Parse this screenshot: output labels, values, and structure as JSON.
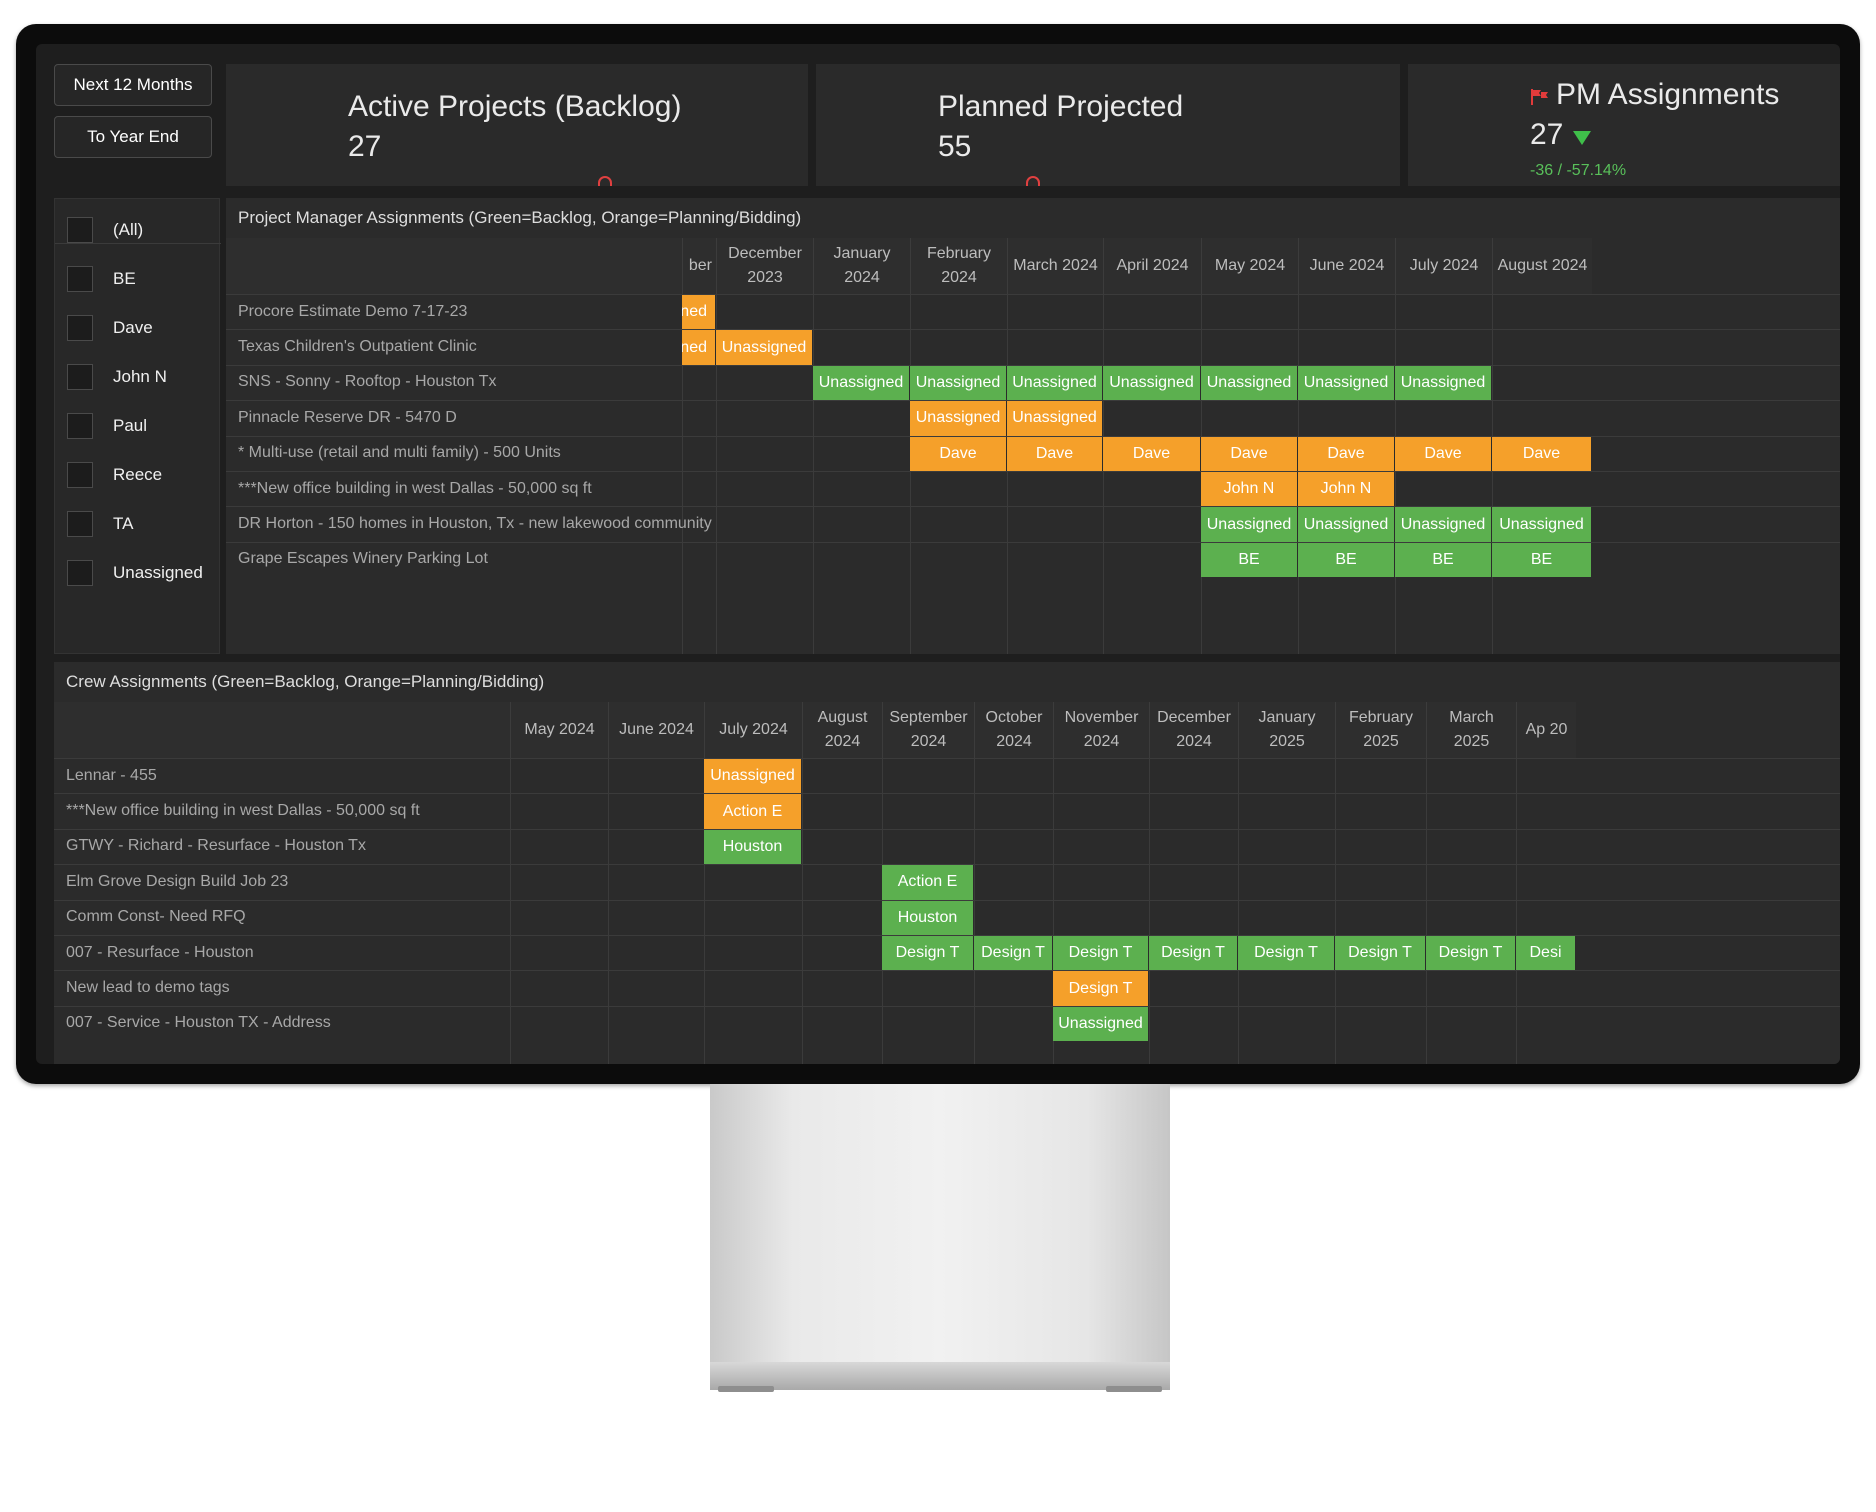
{
  "filters_time": {
    "next12": "Next 12 Months",
    "year_end": "To Year End"
  },
  "kpis": [
    {
      "title": "Active Projects (Backlog)",
      "value": "27"
    },
    {
      "title": "Planned Projected",
      "value": "55"
    },
    {
      "title": "PM Assignments",
      "value": "27",
      "delta": "-36 / -57.14%"
    }
  ],
  "colors": {
    "green": "#5cb04f",
    "orange": "#f5a02a"
  },
  "pm_filter": [
    "(All)",
    "BE",
    "Dave",
    "John N",
    "Paul",
    "Reece",
    "TA",
    "Unassigned"
  ],
  "pm_grid": {
    "title": "Project Manager Assignments (Green=Backlog, Orange=Planning/Bidding)",
    "months": [
      "ber",
      "December 2023",
      "January 2024",
      "February 2024",
      "March 2024",
      "April 2024",
      "May 2024",
      "June 2024",
      "July 2024",
      "August 2024"
    ],
    "rows": [
      {
        "label": "Procore Estimate Demo 7-17-23",
        "cells": [
          {
            "col": 0,
            "text": "ned",
            "c": "o"
          }
        ]
      },
      {
        "label": "Texas Children's Outpatient Clinic",
        "cells": [
          {
            "col": 0,
            "text": "ned",
            "c": "o"
          },
          {
            "col": 1,
            "text": "Unassigned",
            "c": "o"
          }
        ]
      },
      {
        "label": "SNS - Sonny - Rooftop - Houston Tx",
        "cells": [
          {
            "col": 2,
            "text": "Unassigned",
            "c": "g"
          },
          {
            "col": 3,
            "text": "Unassigned",
            "c": "g"
          },
          {
            "col": 4,
            "text": "Unassigned",
            "c": "g"
          },
          {
            "col": 5,
            "text": "Unassigned",
            "c": "g"
          },
          {
            "col": 6,
            "text": "Unassigned",
            "c": "g"
          },
          {
            "col": 7,
            "text": "Unassigned",
            "c": "g"
          },
          {
            "col": 8,
            "text": "Unassigned",
            "c": "g"
          }
        ]
      },
      {
        "label": "Pinnacle Reserve DR - 5470 D",
        "cells": [
          {
            "col": 3,
            "text": "Unassigned",
            "c": "o"
          },
          {
            "col": 4,
            "text": "Unassigned",
            "c": "o"
          }
        ]
      },
      {
        "label": "* Multi-use (retail and multi family) - 500 Units",
        "cells": [
          {
            "col": 3,
            "text": "Dave",
            "c": "o"
          },
          {
            "col": 4,
            "text": "Dave",
            "c": "o"
          },
          {
            "col": 5,
            "text": "Dave",
            "c": "o"
          },
          {
            "col": 6,
            "text": "Dave",
            "c": "o"
          },
          {
            "col": 7,
            "text": "Dave",
            "c": "o"
          },
          {
            "col": 8,
            "text": "Dave",
            "c": "o"
          },
          {
            "col": 9,
            "text": "Dave",
            "c": "o"
          }
        ]
      },
      {
        "label": "***New office building in west Dallas - 50,000 sq ft",
        "cells": [
          {
            "col": 6,
            "text": "John N",
            "c": "o"
          },
          {
            "col": 7,
            "text": "John N",
            "c": "o"
          }
        ]
      },
      {
        "label": "DR Horton - 150 homes in Houston, Tx - new lakewood community",
        "cells": [
          {
            "col": 6,
            "text": "Unassigned",
            "c": "g"
          },
          {
            "col": 7,
            "text": "Unassigned",
            "c": "g"
          },
          {
            "col": 8,
            "text": "Unassigned",
            "c": "g"
          },
          {
            "col": 9,
            "text": "Unassigned",
            "c": "g"
          }
        ]
      },
      {
        "label": "Grape Escapes Winery Parking Lot",
        "cells": [
          {
            "col": 6,
            "text": "BE",
            "c": "g"
          },
          {
            "col": 7,
            "text": "BE",
            "c": "g"
          },
          {
            "col": 8,
            "text": "BE",
            "c": "g"
          },
          {
            "col": 9,
            "text": "BE",
            "c": "g"
          }
        ]
      }
    ]
  },
  "crew_grid": {
    "title": "Crew Assignments (Green=Backlog, Orange=Planning/Bidding)",
    "months": [
      "May 2024",
      "June 2024",
      "July 2024",
      "August 2024",
      "September 2024",
      "October 2024",
      "November 2024",
      "December 2024",
      "January 2025",
      "February 2025",
      "March 2025",
      "Ap 20"
    ],
    "rows": [
      {
        "label": "Lennar - 455",
        "cells": [
          {
            "col": 2,
            "text": "Unassigned",
            "c": "o"
          }
        ]
      },
      {
        "label": "***New office building in west Dallas - 50,000 sq ft",
        "cells": [
          {
            "col": 2,
            "text": "Action E",
            "c": "o"
          }
        ]
      },
      {
        "label": "GTWY - Richard - Resurface - Houston Tx",
        "cells": [
          {
            "col": 2,
            "text": "Houston",
            "c": "g"
          }
        ]
      },
      {
        "label": "Elm Grove Design Build Job 23",
        "cells": [
          {
            "col": 4,
            "text": "Action E",
            "c": "g"
          }
        ]
      },
      {
        "label": "Comm Const- Need RFQ",
        "cells": [
          {
            "col": 4,
            "text": "Houston",
            "c": "g"
          }
        ]
      },
      {
        "label": "007 - Resurface - Houston",
        "cells": [
          {
            "col": 4,
            "text": "Design T",
            "c": "g"
          },
          {
            "col": 5,
            "text": "Design T",
            "c": "g"
          },
          {
            "col": 6,
            "text": "Design T",
            "c": "g"
          },
          {
            "col": 7,
            "text": "Design T",
            "c": "g"
          },
          {
            "col": 8,
            "text": "Design T",
            "c": "g"
          },
          {
            "col": 9,
            "text": "Design T",
            "c": "g"
          },
          {
            "col": 10,
            "text": "Design T",
            "c": "g"
          },
          {
            "col": 11,
            "text": "Desi",
            "c": "g"
          }
        ]
      },
      {
        "label": "New lead to demo tags",
        "cells": [
          {
            "col": 6,
            "text": "Design T",
            "c": "o"
          }
        ]
      },
      {
        "label": "007 - Service - Houston TX - Address",
        "cells": [
          {
            "col": 6,
            "text": "Unassigned",
            "c": "g"
          }
        ]
      }
    ]
  }
}
